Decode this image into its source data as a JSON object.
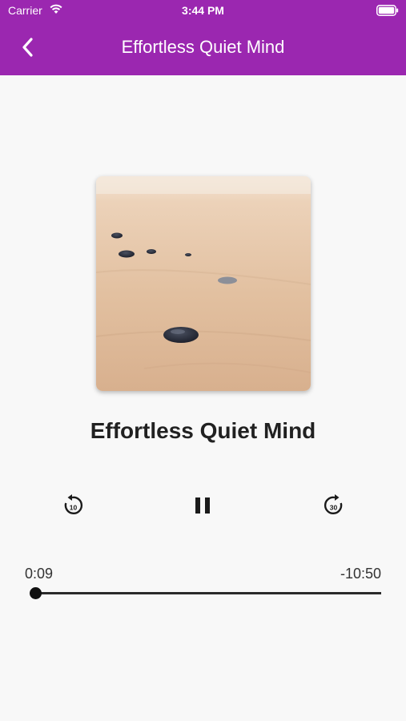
{
  "status_bar": {
    "carrier": "Carrier",
    "time": "3:44 PM"
  },
  "header": {
    "title": "Effortless Quiet Mind",
    "background_color": "#9b27b0"
  },
  "player": {
    "track_title": "Effortless Quiet Mind",
    "artwork_icon": "sand-stones-image",
    "controls": {
      "rewind_icon": "rewind-10-icon",
      "rewind_seconds": "10",
      "pause_icon": "pause-icon",
      "forward_icon": "forward-30-icon",
      "forward_seconds": "30"
    },
    "elapsed": "0:09",
    "remaining": "-10:50",
    "progress_fraction": 0.014
  }
}
